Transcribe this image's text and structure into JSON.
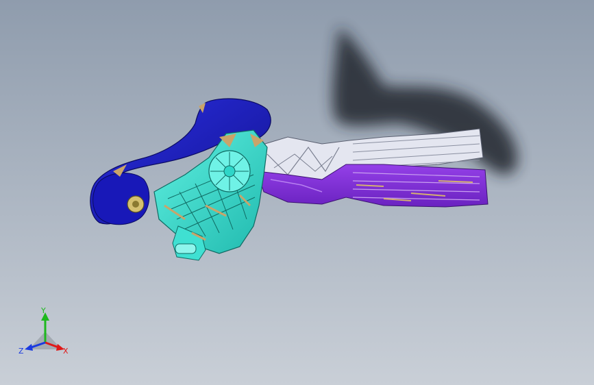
{
  "viewport": {
    "background_top": "#8f9cad",
    "background_bottom": "#c9cfd7"
  },
  "model": {
    "parts": [
      {
        "name": "mount-bracket",
        "color": "#1a1aa8"
      },
      {
        "name": "sensor-housing",
        "color": "#2fd6c8"
      },
      {
        "name": "pedal-arm",
        "color": "#e4e6f0"
      },
      {
        "name": "pedal-pad",
        "color": "#7a2fd0"
      },
      {
        "name": "interference-regions",
        "color": "#c9a46a"
      }
    ],
    "shadow_color": "#2a2e36"
  },
  "triad": {
    "y_label": "Y",
    "x_label": "X",
    "z_label": "Z",
    "y_color": "#1db81d",
    "x_color": "#e01818",
    "z_color": "#1a3ae0"
  }
}
